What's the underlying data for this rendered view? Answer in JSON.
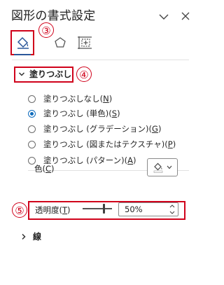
{
  "pane": {
    "title": "図形の書式設定",
    "collapse_icon": "chevron-down-icon",
    "close_icon": "close-icon"
  },
  "tabs": [
    {
      "name": "fill-and-line",
      "icon": "paint-bucket-icon",
      "selected": true
    },
    {
      "name": "effects",
      "icon": "pentagon-icon",
      "selected": false
    },
    {
      "name": "size-and-properties",
      "icon": "size-layout-icon",
      "selected": false
    }
  ],
  "annotations": {
    "a3": "③",
    "a4": "④",
    "a5": "⑤"
  },
  "fill_section": {
    "label": "塗りつぶし",
    "options": [
      {
        "label": "塗りつぶしなし",
        "key": "N",
        "selected": false
      },
      {
        "label": "塗りつぶし (単色)",
        "key": "S",
        "selected": true
      },
      {
        "label": "塗りつぶし (グラデーション)",
        "key": "G",
        "selected": false
      },
      {
        "label": "塗りつぶし (図またはテクスチャ)",
        "key": "P",
        "selected": false
      },
      {
        "label": "塗りつぶし (パターン)",
        "key": "A",
        "selected": false
      }
    ],
    "color_label": "色",
    "color_key": "C",
    "color_swatch": "#ffffff",
    "transparency_label": "透明度",
    "transparency_key": "T",
    "transparency_value": "50%",
    "transparency_fraction": 0.5
  },
  "line_section": {
    "label": "線"
  },
  "colors": {
    "annotation_red": "#d0021b",
    "accent_blue": "#0f6cbd"
  }
}
